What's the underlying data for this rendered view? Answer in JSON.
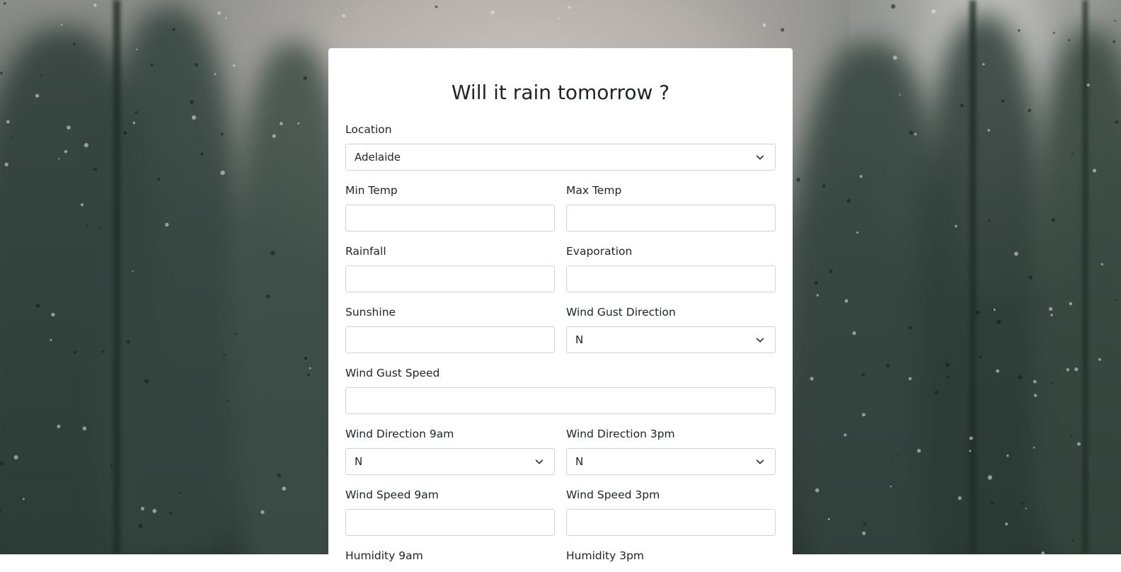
{
  "form": {
    "title": "Will it rain tomorrow ?",
    "location": {
      "label": "Location",
      "value": "Adelaide"
    },
    "min_temp": {
      "label": "Min Temp",
      "value": ""
    },
    "max_temp": {
      "label": "Max Temp",
      "value": ""
    },
    "rainfall": {
      "label": "Rainfall",
      "value": ""
    },
    "evaporation": {
      "label": "Evaporation",
      "value": ""
    },
    "sunshine": {
      "label": "Sunshine",
      "value": ""
    },
    "wind_gust_direction": {
      "label": "Wind Gust Direction",
      "value": "N"
    },
    "wind_gust_speed": {
      "label": "Wind Gust Speed",
      "value": ""
    },
    "wind_direction_9am": {
      "label": "Wind Direction 9am",
      "value": "N"
    },
    "wind_direction_3pm": {
      "label": "Wind Direction 3pm",
      "value": "N"
    },
    "wind_speed_9am": {
      "label": "Wind Speed 9am",
      "value": ""
    },
    "wind_speed_3pm": {
      "label": "Wind Speed 3pm",
      "value": ""
    },
    "humidity_9am": {
      "label": "Humidity 9am"
    },
    "humidity_3pm": {
      "label": "Humidity 3pm"
    }
  },
  "colors": {
    "card_bg": "#ffffff",
    "text": "#212529",
    "border": "#ced4da"
  },
  "icons": {
    "select_arrow": "chevron-down-icon"
  }
}
